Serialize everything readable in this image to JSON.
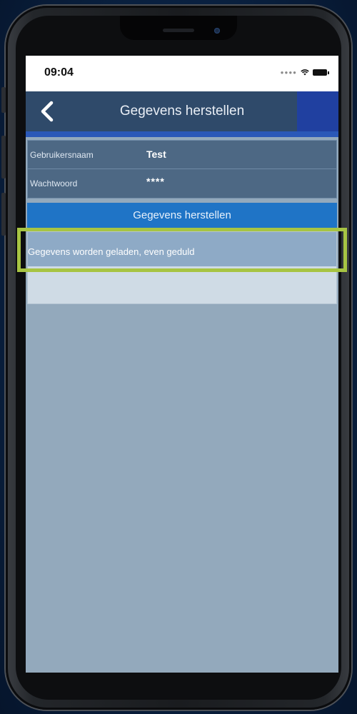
{
  "status_bar": {
    "time": "09:04"
  },
  "nav": {
    "title": "Gegevens herstellen",
    "back_icon": "chevron-left-icon"
  },
  "form": {
    "rows": [
      {
        "label": "Gebruikersnaam",
        "value": "Test"
      },
      {
        "label": "Wachtwoord",
        "value": "****"
      }
    ]
  },
  "action": {
    "label": "Gegevens herstellen"
  },
  "loading": {
    "message": "Gegevens worden geladen, even geduld"
  },
  "colors": {
    "nav_background": "#2f4a6a",
    "nav_accent": "#2040a0",
    "button_blue": "#1f74c6",
    "screen_background": "#93a9bc",
    "highlight": "#a7c443"
  }
}
